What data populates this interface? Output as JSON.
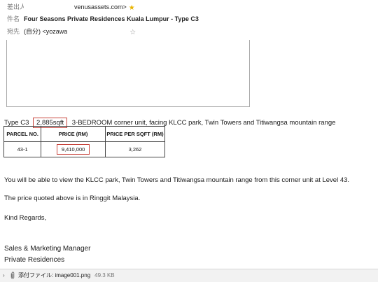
{
  "header": {
    "from_label": "差出人",
    "from_value": "venusassets.com>",
    "subject_label": "件名",
    "subject_value": "Four Seasons Private Residences Kuala Lumpur - Type C3",
    "to_label": "宛先",
    "to_value": "(自分) <yozawa"
  },
  "body": {
    "type_prefix": "Type C3",
    "sqft": "2,885sqft",
    "type_desc": "3-BEDROOM corner unit, facing KLCC park, Twin Towers and Titiwangsa mountain range",
    "table": {
      "headers": [
        "PARCEL NO.",
        "PRICE (RM)",
        "PRICE PER SQFT (RM)"
      ],
      "rows": [
        [
          "43-1",
          "9,410,000",
          "3,262"
        ]
      ]
    },
    "p1": "You will be able to view the KLCC park, Twin Towers and Titiwangsa mountain range from this corner unit at Level 43.",
    "p2": "The price quoted above is in Ringgit Malaysia.",
    "p3": "Kind Regards,",
    "sig1": "Sales & Marketing Manager",
    "sig2": "Private Residences"
  },
  "attachment": {
    "label": "添付ファイル: image001.png",
    "size": "49.3 KB"
  },
  "icons": {
    "star_filled": "star-filled-icon",
    "star_outline": "star-outline-icon",
    "expand": "chevron-right-icon",
    "clip": "paperclip-icon"
  },
  "colors": {
    "highlight_box": "#c8453d",
    "star_yellow": "#e9b400",
    "attach_bar": "#f2f2f2"
  }
}
